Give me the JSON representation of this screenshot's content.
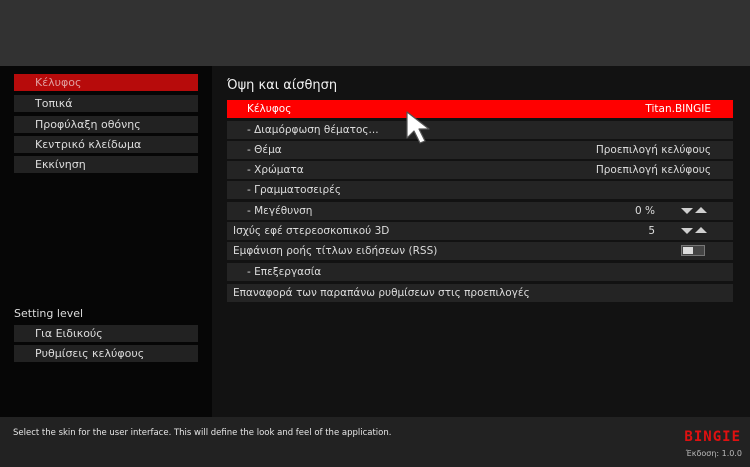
{
  "categories": [
    {
      "label": "Κέλυφος",
      "active": true
    },
    {
      "label": "Τοπικά",
      "active": false
    },
    {
      "label": "Προφύλαξη οθόνης",
      "active": false
    },
    {
      "label": "Κεντρικό κλείδωμα",
      "active": false
    },
    {
      "label": "Εκκίνηση",
      "active": false
    }
  ],
  "setting_level": {
    "label": "Setting level",
    "options": [
      "Για Ειδικούς",
      "Ρυθμίσεις κελύφους"
    ]
  },
  "section": {
    "title": "Όψη και αίσθηση",
    "rows": [
      {
        "label": "Κέλυφος",
        "value": "Titan.BINGIE"
      },
      {
        "label": "- Διαμόρφωση θέματος..."
      },
      {
        "label": "- Θέμα",
        "value": "Προεπιλογή κελύφους"
      },
      {
        "label": "- Χρώματα",
        "value": "Προεπιλογή κελύφους"
      },
      {
        "label": "- Γραμματοσειρές"
      },
      {
        "label": "- Μεγέθυνση",
        "value": "0 %"
      },
      {
        "label": "Ισχύς εφέ στερεοσκοπικού 3D",
        "value": "5"
      },
      {
        "label": "Εμφάνιση ροής τίτλων ειδήσεων (RSS)"
      },
      {
        "label": "- Επεξεργασία"
      },
      {
        "label": "Επαναφορά των παραπάνω ρυθμίσεων στις προεπιλογές"
      }
    ]
  },
  "footer": {
    "description": "Select the skin for the user interface. This will define the look and feel of the application.",
    "brand": "BINGIE",
    "version": "Έκδοση: 1.0.0"
  },
  "colors": {
    "accent": "#ff0000",
    "active_category": "#b70b0b"
  },
  "icons": [
    "mouse-cursor-icon",
    "arrow-down-icon",
    "arrow-up-icon",
    "bingie-logo"
  ]
}
